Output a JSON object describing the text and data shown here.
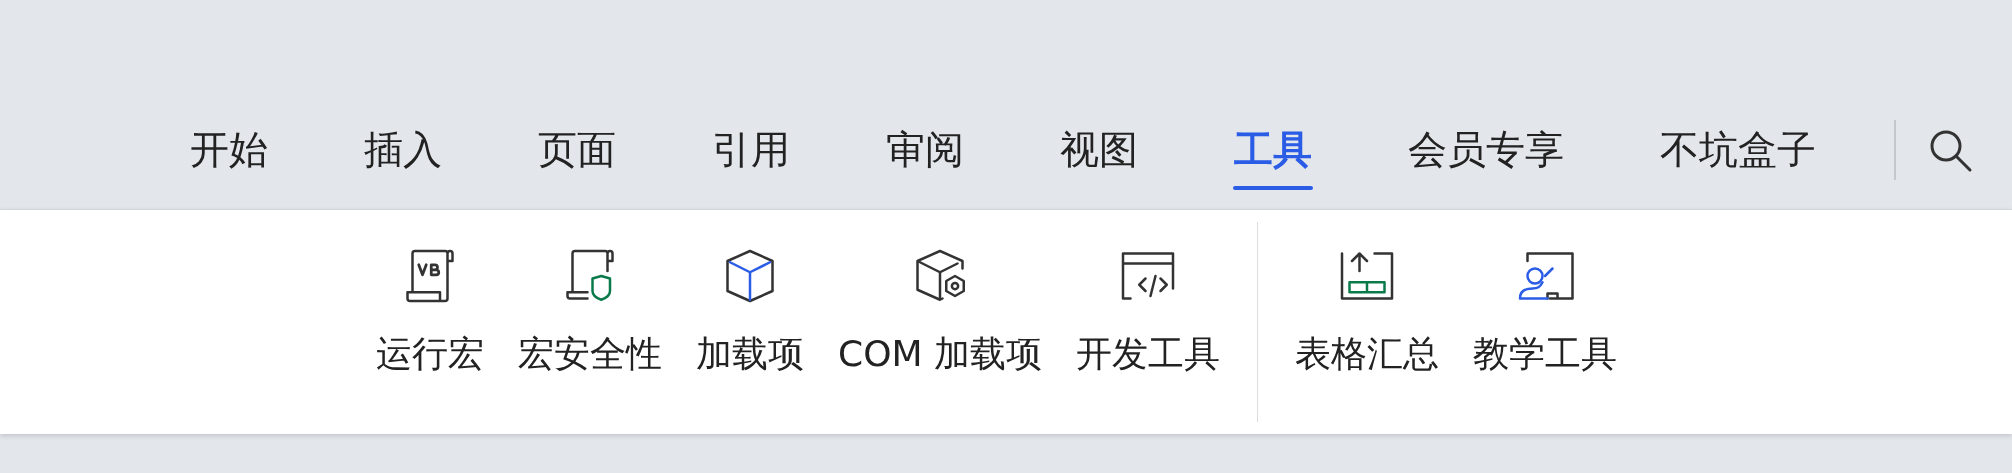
{
  "tabs": [
    {
      "label": "开始",
      "selected": false
    },
    {
      "label": "插入",
      "selected": false
    },
    {
      "label": "页面",
      "selected": false
    },
    {
      "label": "引用",
      "selected": false
    },
    {
      "label": "审阅",
      "selected": false
    },
    {
      "label": "视图",
      "selected": false
    },
    {
      "label": "工具",
      "selected": true
    },
    {
      "label": "会员专享",
      "selected": false
    },
    {
      "label": "不坑盒子",
      "selected": false
    }
  ],
  "ribbon": {
    "groups": [
      {
        "items": [
          {
            "label": "运行宏"
          },
          {
            "label": "宏安全性"
          },
          {
            "label": "加载项"
          },
          {
            "label": "COM 加载项"
          },
          {
            "label": "开发工具"
          }
        ]
      },
      {
        "items": [
          {
            "label": "表格汇总"
          },
          {
            "label": "教学工具"
          }
        ]
      }
    ]
  }
}
